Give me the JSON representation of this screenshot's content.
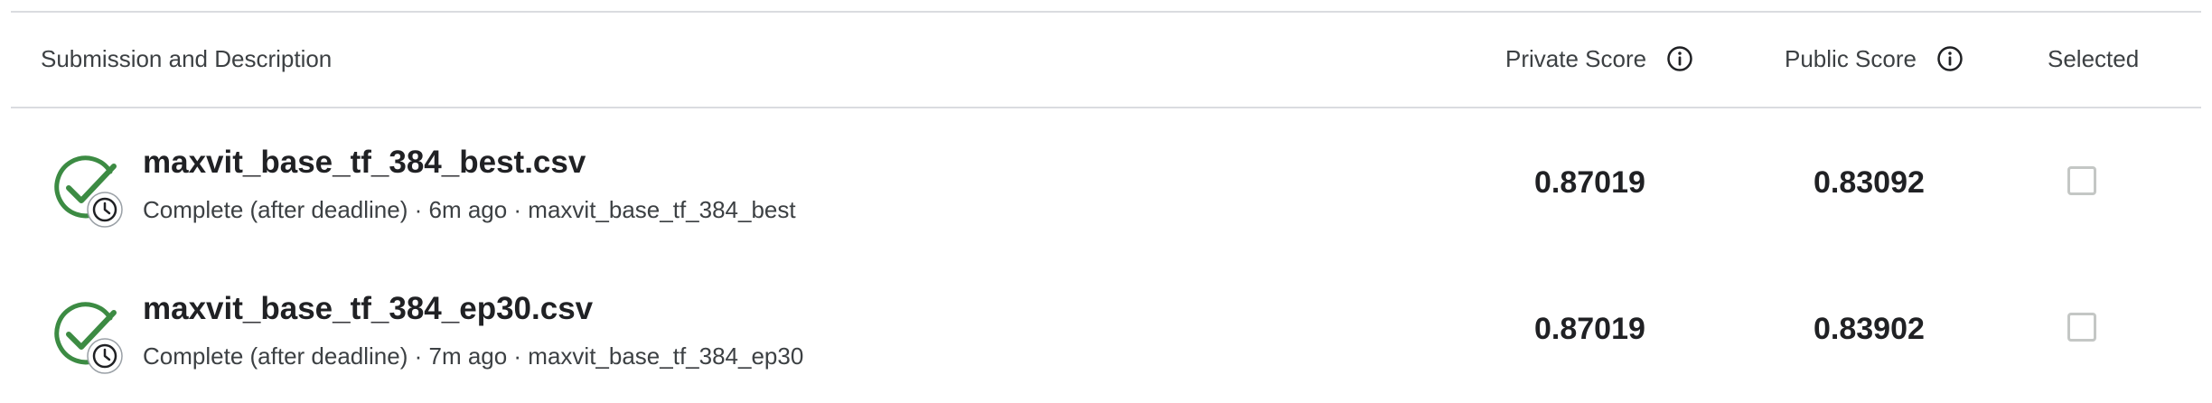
{
  "header": {
    "submission_label": "Submission and Description",
    "private_label": "Private Score",
    "public_label": "Public Score",
    "selected_label": "Selected"
  },
  "rows": [
    {
      "file": "maxvit_base_tf_384_best.csv",
      "description": "Complete (after deadline) · 6m ago · maxvit_base_tf_384_best",
      "private_score": "0.87019",
      "public_score": "0.83092",
      "selected": false
    },
    {
      "file": "maxvit_base_tf_384_ep30.csv",
      "description": "Complete (after deadline) · 7m ago · maxvit_base_tf_384_ep30",
      "private_score": "0.87019",
      "public_score": "0.83902",
      "selected": false
    }
  ],
  "colors": {
    "success": "#3c8b43",
    "border": "#dadce0",
    "text": "#202124"
  },
  "icons": {
    "status": "check-circle-with-clock-icon",
    "info": "info-icon"
  }
}
